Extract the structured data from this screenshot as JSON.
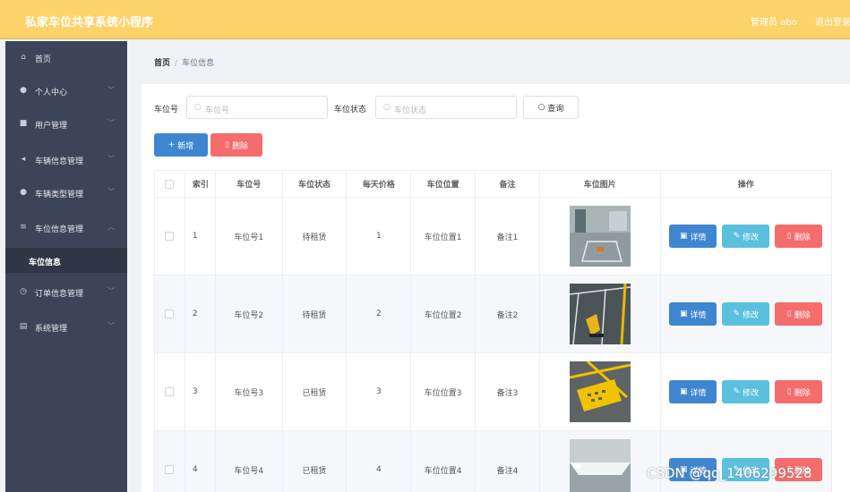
{
  "topbar": {
    "title": "私家车位共享系统小程序",
    "user": "管理员 abo",
    "logout": "退出登录"
  },
  "sidebar": {
    "items": [
      {
        "label": "首页",
        "icon": "home-icon",
        "glyph": "⌂",
        "arrow": ""
      },
      {
        "label": "个人中心",
        "icon": "user-icon",
        "glyph": "●",
        "arrow": "﹀"
      },
      {
        "label": "用户管理",
        "icon": "users-icon",
        "glyph": "■",
        "arrow": "﹀"
      },
      {
        "label": "车辆信息管理",
        "icon": "send-icon",
        "glyph": "◂",
        "arrow": "﹀"
      },
      {
        "label": "车辆类型管理",
        "icon": "person-icon",
        "glyph": "●",
        "arrow": "﹀"
      },
      {
        "label": "车位信息管理",
        "icon": "tickets-icon",
        "glyph": "≡",
        "arrow": "︿"
      },
      {
        "label": "订单信息管理",
        "icon": "clock-icon",
        "glyph": "◷",
        "arrow": "﹀"
      },
      {
        "label": "系统管理",
        "icon": "doc-icon",
        "glyph": "▤",
        "arrow": "﹀"
      }
    ],
    "sub_item": "车位信息"
  },
  "breadcrumb": {
    "home": "首页",
    "sep": "/",
    "current": "车位信息"
  },
  "search": {
    "no_label": "车位号",
    "no_placeholder": "车位号",
    "status_label": "车位状态",
    "status_placeholder": "车位状态",
    "query_label": "查询"
  },
  "actions": {
    "add_label": "新增",
    "delete_label": "删除"
  },
  "table": {
    "headers": [
      "索引",
      "车位号",
      "车位状态",
      "每天价格",
      "车位位置",
      "备注",
      "车位图片",
      "操作"
    ],
    "detail_label": "详情",
    "edit_label": "修改",
    "delete_label": "删除",
    "rows": [
      {
        "index": "1",
        "no": "车位号1",
        "status": "待租赁",
        "price": "1",
        "position": "车位位置1",
        "remark": "备注1",
        "image": "parking-garage-image"
      },
      {
        "index": "2",
        "no": "车位号2",
        "status": "待租赁",
        "price": "2",
        "position": "车位位置2",
        "remark": "备注2",
        "image": "parking-lock-image"
      },
      {
        "index": "3",
        "no": "车位号3",
        "status": "已租赁",
        "price": "3",
        "position": "车位位置3",
        "remark": "备注3",
        "image": "yellow-marking-image"
      },
      {
        "index": "4",
        "no": "车位号4",
        "status": "已租赁",
        "price": "4",
        "position": "车位位置4",
        "remark": "备注4",
        "image": "garage-wall-image"
      }
    ]
  },
  "watermark": "CSDN @qq_1406299528"
}
